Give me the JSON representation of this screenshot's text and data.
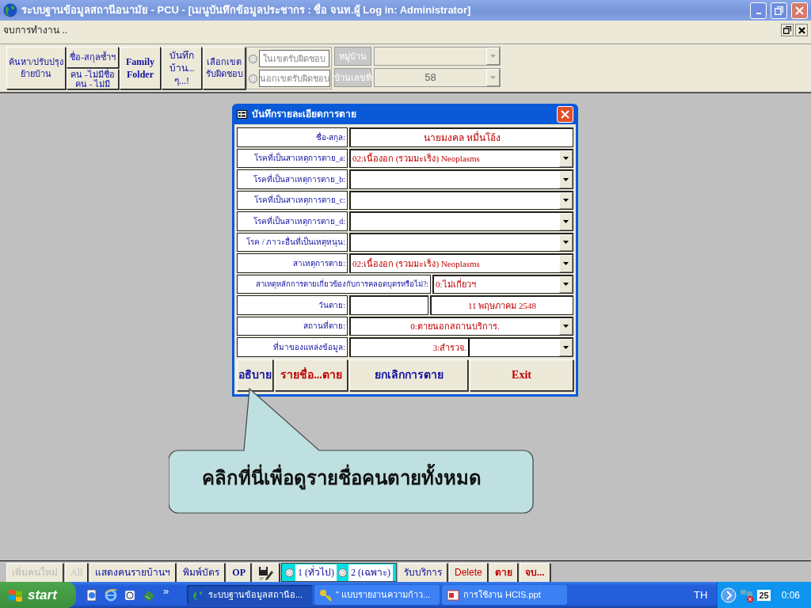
{
  "window": {
    "title": "ระบบฐานข้อมูลสถานีอนามัย - PCU - [เมนูบันทึกข้อมูลประชากร : ชื่อ จนท.ผู้ Log in: Administrator]"
  },
  "menu": {
    "label": "จบการทำงาน .."
  },
  "toolbar": [
    {
      "kind": "button",
      "label": "ค้นหา/ปรับปรุง\nย้ายบ้าน"
    },
    {
      "kind": "stack",
      "buttons": [
        "ชื่อ-สกุลซ้ำฯ",
        "คน -ไม่มีชื่อ\nคน - ไม่มี"
      ]
    },
    {
      "kind": "button",
      "label": "Family\nFolder"
    },
    {
      "kind": "button",
      "label": "บันทึก\nบ้าน...\nๆ...!"
    },
    {
      "kind": "button",
      "label": "เลือกเขต\nรับผิดชอบ"
    },
    {
      "kind": "radio_group",
      "options": [
        {
          "label": "ในเขตรับผิดชอบ",
          "selected": false
        },
        {
          "label": "นอกเขตรับผิดชอบ",
          "selected": false
        }
      ]
    },
    {
      "kind": "lookup",
      "rows": [
        {
          "label": "หมู่บ้าน"
        },
        {
          "label": "บ้านเลขที่",
          "value": "58"
        }
      ]
    }
  ],
  "dialog": {
    "title": "บันทึกรายละเอียดการตาย",
    "fields": [
      {
        "kind": "text",
        "label": "ชื่อ-สกุล:",
        "value": "นายมงคล  หมื่นโอ้ง"
      },
      {
        "kind": "combo",
        "label": "โรคที่เป็นสาเหตุการตาย_a:",
        "value": "02:เนื้องอก (รวมมะเร็ง)  Neoplasms"
      },
      {
        "kind": "combo",
        "label": "โรคที่เป็นสาเหตุการตาย_b:"
      },
      {
        "kind": "combo",
        "label": "โรคที่เป็นสาเหตุการตาย_c:"
      },
      {
        "kind": "combo",
        "label": "โรคที่เป็นสาเหตุการตาย_d:"
      },
      {
        "kind": "combo",
        "label": "โรค / ภาวะอื่นที่เป็นเหตุหนุน:"
      },
      {
        "kind": "combo",
        "label": "สาเหตุการตาย:",
        "value": "02:เนื้องอก (รวมมะเร็ง)  Neoplasms"
      },
      {
        "kind": "wide_combo",
        "label": "สาเหตุหลักการตายเกี่ยวข้องกับการคลอดบุตรหรือไม่?:",
        "value": "0:ไม่เกี่ยวฯ"
      },
      {
        "kind": "date",
        "label": "วันตาย:",
        "value": "11 พฤษภาคม 2548"
      },
      {
        "kind": "centered_combo",
        "label": "สถานที่ตาย:",
        "value": "0:ตายนอกสถานบริการ."
      },
      {
        "kind": "split_combo",
        "label": "ที่มาของแหล่งข้อมูล:",
        "value": "3:สำรวจ."
      }
    ],
    "buttons": [
      {
        "label": "อธิบาย",
        "color": "#1010a0"
      },
      {
        "label": "รายชื่อ...ตาย",
        "color": "#c00000"
      },
      {
        "label": "ยกเลิกการตาย",
        "color": "#1010a0"
      },
      {
        "label": "Exit",
        "color": "#c00000"
      }
    ]
  },
  "callout": {
    "text": "คลิกที่นี่เพื่อดูรายชื่อคนตายทั้งหมด"
  },
  "bottom_bar": [
    {
      "kind": "button",
      "label": "เพิ่มคนใหม่",
      "disabled": true
    },
    {
      "kind": "button",
      "label": "All",
      "disabled": true
    },
    {
      "kind": "button",
      "label": "แสดงคนรายบ้านฯ",
      "disabled": false,
      "color": "#1010a0"
    },
    {
      "kind": "button",
      "label": "พิมพ์บัตร",
      "disabled": false,
      "color": "#1010a0"
    },
    {
      "kind": "button",
      "label": "OP",
      "disabled": false,
      "color": "#1010a0"
    },
    {
      "kind": "icon_button"
    },
    {
      "kind": "radio_group",
      "options": [
        {
          "label": "1 (ทั่วไป)",
          "selected": false
        },
        {
          "label": "2 (เฉพาะ)",
          "selected": false
        }
      ]
    },
    {
      "kind": "button",
      "label": "รับบริการ",
      "disabled": false,
      "color": "#1010a0"
    },
    {
      "kind": "button",
      "label": "Delete",
      "disabled": false,
      "color": "#c00000"
    },
    {
      "kind": "button",
      "label": "ตาย",
      "disabled": false,
      "color": "#c00000"
    },
    {
      "kind": "button",
      "label": "จบ...",
      "disabled": false,
      "color": "#c00000"
    }
  ],
  "taskbar": {
    "start": "start",
    "more": "»",
    "tasks": [
      {
        "label": "ระบบฐานข้อมูลสถานีอ...",
        "selected": true
      },
      {
        "label": "\" แบบรายงานความก้าว...",
        "selected": false
      },
      {
        "label": "การใช้งาน HCIS.ppt",
        "selected": false
      }
    ],
    "language": "TH",
    "tray_badge": "25",
    "clock": "0:06"
  }
}
